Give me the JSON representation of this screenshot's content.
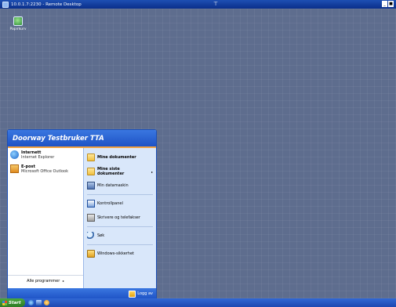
{
  "window": {
    "title": "10.0.1.7:2230 - Remote Desktop",
    "minimize": "_",
    "close": "■"
  },
  "desktop": {
    "icons": [
      {
        "label": "Papirkurv",
        "icon": "recycle-bin-icon"
      }
    ]
  },
  "start_menu": {
    "user_name": "Doorway Testbruker TTA",
    "pinned": [
      {
        "title": "Internett",
        "subtitle": "Internet Explorer",
        "icon": "internet-explorer-icon"
      },
      {
        "title": "E-post",
        "subtitle": "Microsoft Office Outlook",
        "icon": "outlook-icon"
      }
    ],
    "all_programs": "Alle programmer",
    "all_programs_arrow": "▸",
    "right": [
      {
        "label": "Mine dokumenter",
        "icon": "folder-icon",
        "bold": true
      },
      {
        "label": "Mine siste dokumenter",
        "icon": "folder-icon",
        "bold": true,
        "arrow": "▸"
      },
      {
        "label": "Min datamaskin",
        "icon": "computer-icon",
        "bold": false
      },
      {
        "label": "Kontrollpanel",
        "icon": "control-panel-icon",
        "bold": false
      },
      {
        "label": "Skrivere og telefakser",
        "icon": "printer-icon",
        "bold": false
      },
      {
        "label": "Søk",
        "icon": "search-icon",
        "bold": false
      },
      {
        "label": "Windows-sikkerhet",
        "icon": "security-icon",
        "bold": false
      }
    ],
    "log_off": "Logg av"
  },
  "taskbar": {
    "start_label": "Start"
  }
}
